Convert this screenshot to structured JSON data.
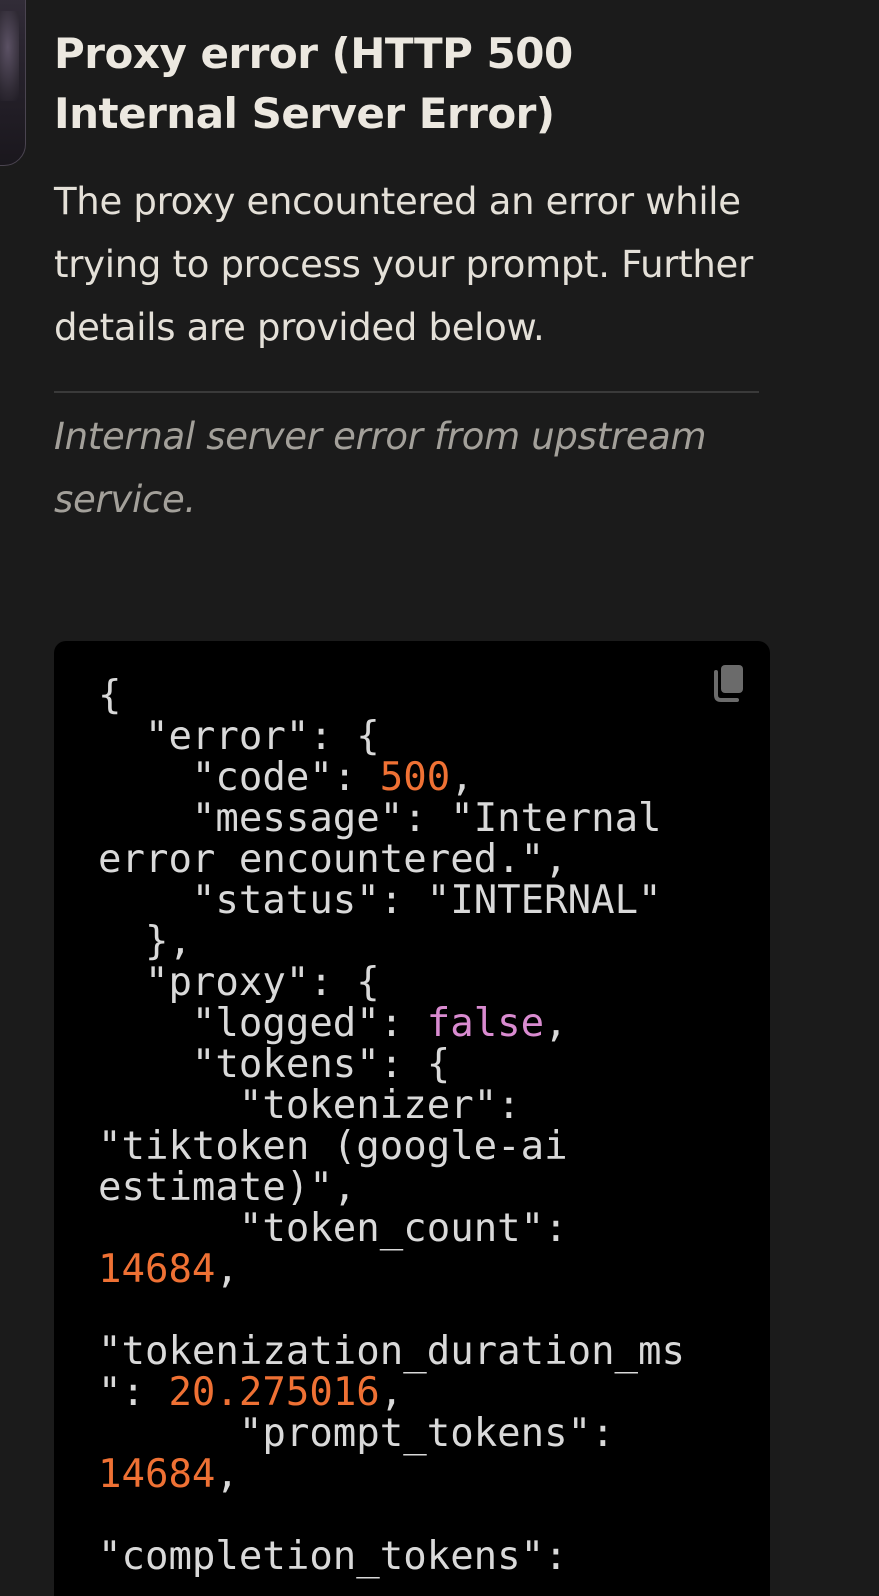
{
  "page": {
    "title_line1": "Proxy error (HTTP 500",
    "title_line2": "Internal Server Error)",
    "intro": "The proxy encountered an error while trying to process your prompt. Further details are provided below.",
    "detail": "Internal server error from upstream service."
  },
  "code": {
    "open_brace": "{",
    "error_key": "\"error\"",
    "code_key": "\"code\"",
    "code_value": "500",
    "message_key": "\"message\"",
    "message_value_part1": "\"Internal",
    "message_value_part2": "error encountered.\"",
    "status_key": "\"status\"",
    "status_value": "\"INTERNAL\"",
    "close_error": "},",
    "proxy_key": "\"proxy\"",
    "logged_key": "\"logged\"",
    "logged_value": "false",
    "tokens_key": "\"tokens\"",
    "tokenizer_key": "\"tokenizer\"",
    "tokenizer_value_part1": "\"tiktoken (google-ai",
    "tokenizer_value_part2": "estimate)\"",
    "token_count_key": "\"token_count\"",
    "token_count_value": "14684",
    "tokenization_duration_key_part1": "\"tokenization_duration_ms",
    "tokenization_duration_key_part2": "\"",
    "tokenization_duration_value": "20.275016",
    "prompt_tokens_key": "\"prompt_tokens\"",
    "prompt_tokens_value": "14684",
    "completion_tokens_key": "\"completion_tokens\""
  },
  "icons": {
    "copy": "copy-icon"
  },
  "colors": {
    "background": "#1b1b1b",
    "code_background": "#000000",
    "number": "#ef7134",
    "keyword": "#d98bd0",
    "muted": "#a3a09a"
  }
}
